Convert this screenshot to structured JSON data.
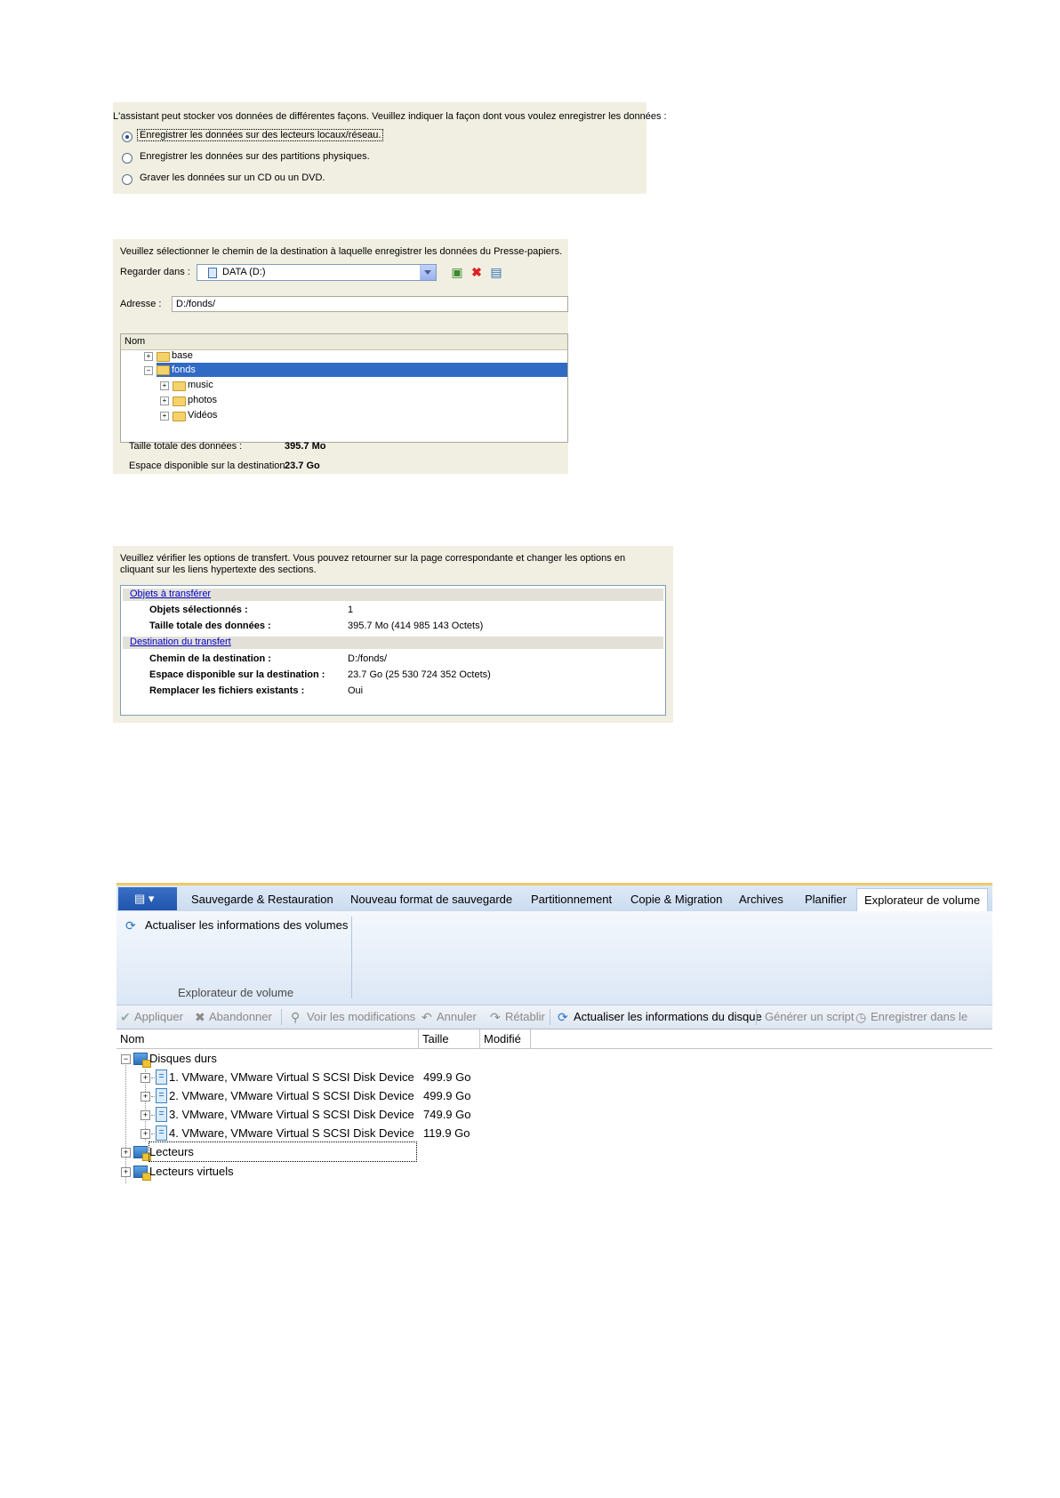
{
  "panel1": {
    "prompt": "L'assistant peut stocker vos données de différentes façons. Veuillez indiquer la façon dont vous voulez enregistrer les données :",
    "options": [
      {
        "label": "Enregistrer les données sur des lecteurs locaux/réseau.",
        "selected": true
      },
      {
        "label": "Enregistrer les données sur des partitions physiques.",
        "selected": false
      },
      {
        "label": "Graver les données sur un CD ou un DVD.",
        "selected": false
      }
    ]
  },
  "panel2": {
    "prompt": "Veuillez sélectionner le chemin de la destination à laquelle enregistrer les données du Presse-papiers.",
    "look_in_label": "Regarder dans :",
    "look_in_value": "DATA (D:)",
    "address_label": "Adresse :",
    "address_value": "D:/fonds/",
    "column_name": "Nom",
    "tree": [
      {
        "label": "base",
        "level": 0,
        "selected": false
      },
      {
        "label": "fonds",
        "level": 0,
        "selected": true
      },
      {
        "label": "music",
        "level": 1,
        "selected": false
      },
      {
        "label": "photos",
        "level": 1,
        "selected": false
      },
      {
        "label": "Vidéos",
        "level": 1,
        "selected": false
      }
    ],
    "total_label": "Taille totale des données :",
    "total_value": "395.7 Mo",
    "space_label": "Espace disponible sur la destination :",
    "space_value": "23.7 Go"
  },
  "panel3": {
    "prompt": "Veuillez vérifier les options de transfert. Vous pouvez retourner sur la page correspondante et changer les options en cliquant sur les liens hypertexte des sections.",
    "section1_link": "Objets à transférer",
    "section1_rows": [
      {
        "label": "Objets sélectionnés :",
        "value": "1"
      },
      {
        "label": "Taille totale des données :",
        "value": "395.7 Mo (414 985 143 Octets)"
      }
    ],
    "section2_link": "Destination du transfert",
    "section2_rows": [
      {
        "label": "Chemin de la destination :",
        "value": "D:/fonds/"
      },
      {
        "label": "Espace disponible sur la destination :",
        "value": "23.7 Go (25 530 724 352 Octets)"
      },
      {
        "label": "Remplacer les fichiers existants :",
        "value": "Oui"
      }
    ]
  },
  "panel4": {
    "tabs": [
      {
        "label": "Sauvegarde & Restauration",
        "active": false
      },
      {
        "label": "Nouveau format de sauvegarde",
        "active": false
      },
      {
        "label": "Partitionnement",
        "active": false
      },
      {
        "label": "Copie & Migration",
        "active": false
      },
      {
        "label": "Archives",
        "active": false
      },
      {
        "label": "Planifier",
        "active": false
      },
      {
        "label": "Explorateur de volume",
        "active": true
      }
    ],
    "ribbon_button": "Actualiser les informations des volumes",
    "ribbon_group": "Explorateur de volume",
    "toolbar": {
      "apply": "Appliquer",
      "discard": "Abandonner",
      "view_changes": "Voir les modifications",
      "undo": "Annuler",
      "redo": "Rétablir",
      "refresh_disk": "Actualiser les informations du disque",
      "script": "Générer un script",
      "save": "Enregistrer dans le"
    },
    "columns": {
      "name": "Nom",
      "size": "Taille",
      "modified": "Modifié"
    },
    "root_hard_disks": "Disques durs",
    "disks": [
      {
        "label": "1. VMware, VMware Virtual S SCSI Disk Device",
        "size": "499.9 Go"
      },
      {
        "label": "2. VMware, VMware Virtual S SCSI Disk Device",
        "size": "499.9 Go"
      },
      {
        "label": "3. VMware, VMware Virtual S SCSI Disk Device",
        "size": "749.9 Go"
      },
      {
        "label": "4. VMware, VMware Virtual S SCSI Disk Device",
        "size": "119.9 Go"
      }
    ],
    "root_drives": "Lecteurs",
    "root_virtual": "Lecteurs virtuels"
  },
  "colors": {
    "selection": "#316ac5",
    "link": "#0000cc",
    "wizard_bg": "#f1efe2",
    "ribbon_accent": "#f0c96a"
  }
}
